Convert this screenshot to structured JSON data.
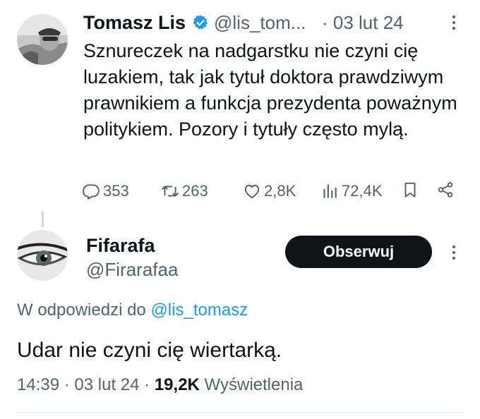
{
  "tweet": {
    "author_name": "Tomasz Lis",
    "handle": "@lis_tom...",
    "time": "· 03 lut 24",
    "text": "Sznureczek na nadgarstku nie czyni cię luzakiem, tak jak tytuł doktora prawdziwym prawnikiem a funkcja prezydenta poważnym politykiem. Pozory i tytuły często mylą.",
    "stats": {
      "replies": "353",
      "reposts": "263",
      "likes": "2,8K",
      "views": "72,4K"
    },
    "icons": [
      "verified-badge-icon",
      "more-icon",
      "reply-icon",
      "repost-icon",
      "like-icon",
      "views-icon",
      "bookmark-icon",
      "share-icon"
    ]
  },
  "reply": {
    "author_name": "Fifarafa",
    "handle": "@Firarafaa",
    "follow_label": "Obserwuj",
    "reply_to_prefix": "W odpowiedzi do",
    "reply_to_handle": "@lis_tomasz",
    "text": "Udar nie czyni cię wiertarką.",
    "time": "14:39",
    "date": "03 lut 24",
    "views_count": "19,2K",
    "views_label": "Wyświetlenia",
    "separator": "·"
  },
  "colors": {
    "text": "#0f1419",
    "muted": "#536471",
    "link": "#1d9bf0",
    "verified": "#1d9bf0",
    "button_bg": "#0f1419"
  }
}
